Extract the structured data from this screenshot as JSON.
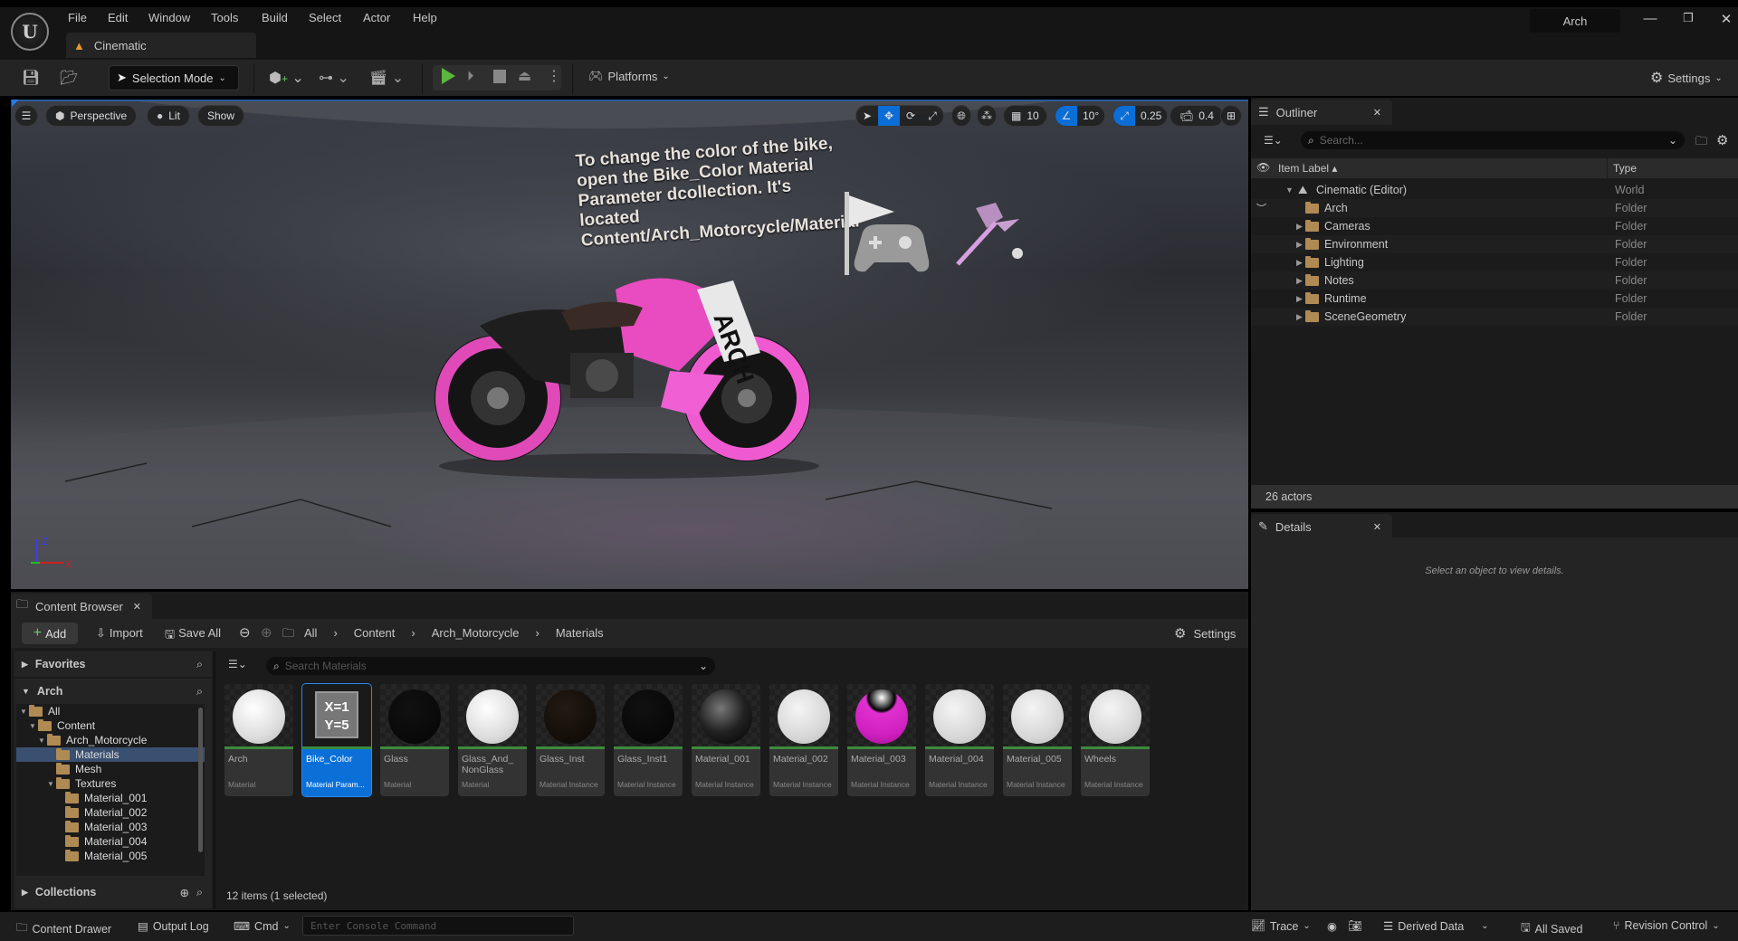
{
  "titlebar": {
    "menu": [
      "File",
      "Edit",
      "Window",
      "Tools",
      "Build",
      "Select",
      "Actor",
      "Help"
    ],
    "level_tab": "Cinematic",
    "project_name": "Arch"
  },
  "toolbar": {
    "selection_mode": "Selection Mode",
    "platforms": "Platforms",
    "settings": "Settings"
  },
  "viewport": {
    "perspective": "Perspective",
    "lit": "Lit",
    "show": "Show",
    "grid_snap": "10",
    "rotation_snap": "10°",
    "scale_snap": "0.25",
    "camera_speed": "0.4",
    "note_text": "To change the color of the bike, open the Bike_Color Material Parameter dcollection. It's located Content/Arch_Motorcycle/Material",
    "axis": {
      "z": "Z",
      "x": "X"
    }
  },
  "outliner": {
    "title": "Outliner",
    "search_placeholder": "Search...",
    "col_label": "Item Label",
    "col_type": "Type",
    "rows": [
      {
        "label": "Cinematic (Editor)",
        "type": "World"
      },
      {
        "label": "Arch",
        "type": "Folder"
      },
      {
        "label": "Cameras",
        "type": "Folder"
      },
      {
        "label": "Environment",
        "type": "Folder"
      },
      {
        "label": "Lighting",
        "type": "Folder"
      },
      {
        "label": "Notes",
        "type": "Folder"
      },
      {
        "label": "Runtime",
        "type": "Folder"
      },
      {
        "label": "SceneGeometry",
        "type": "Folder"
      }
    ],
    "actor_count": "26 actors"
  },
  "details": {
    "title": "Details",
    "empty_text": "Select an object to view details."
  },
  "content_browser": {
    "title": "Content Browser",
    "add": "Add",
    "import": "Import",
    "save_all": "Save All",
    "breadcrumb": [
      "All",
      "Content",
      "Arch_Motorcycle",
      "Materials"
    ],
    "settings": "Settings",
    "search_placeholder": "Search Materials",
    "favorites": "Favorites",
    "arch": "Arch",
    "collections": "Collections",
    "tree": [
      {
        "label": "All",
        "level": 0
      },
      {
        "label": "Content",
        "level": 1
      },
      {
        "label": "Arch_Motorcycle",
        "level": 2
      },
      {
        "label": "Materials",
        "level": 3
      },
      {
        "label": "Mesh",
        "level": 3
      },
      {
        "label": "Textures",
        "level": 3
      },
      {
        "label": "Material_001",
        "level": 4
      },
      {
        "label": "Material_002",
        "level": 4
      },
      {
        "label": "Material_003",
        "level": 4
      },
      {
        "label": "Material_004",
        "level": 4
      },
      {
        "label": "Material_005",
        "level": 4
      }
    ],
    "assets": [
      {
        "name": "Arch",
        "type": "Material"
      },
      {
        "name": "Bike_Color",
        "type": "Material Param..."
      },
      {
        "name": "Glass",
        "type": "Material"
      },
      {
        "name": "Glass_And_ NonGlass",
        "type": "Material"
      },
      {
        "name": "Glass_Inst",
        "type": "Material Instance"
      },
      {
        "name": "Glass_Inst1",
        "type": "Material Instance"
      },
      {
        "name": "Material_001",
        "type": "Material Instance"
      },
      {
        "name": "Material_002",
        "type": "Material Instance"
      },
      {
        "name": "Material_003",
        "type": "Material Instance"
      },
      {
        "name": "Material_004",
        "type": "Material Instance"
      },
      {
        "name": "Material_005",
        "type": "Material Instance"
      },
      {
        "name": "Wheels",
        "type": "Material Instance"
      }
    ],
    "param_icon_text": [
      "X=1",
      "Y=5"
    ],
    "item_count": "12 items (1 selected)"
  },
  "statusbar": {
    "content_drawer": "Content Drawer",
    "output_log": "Output Log",
    "cmd": "Cmd",
    "console_placeholder": "Enter Console Command",
    "trace": "Trace",
    "derived_data": "Derived Data",
    "all_saved": "All Saved",
    "revision_control": "Revision Control"
  }
}
